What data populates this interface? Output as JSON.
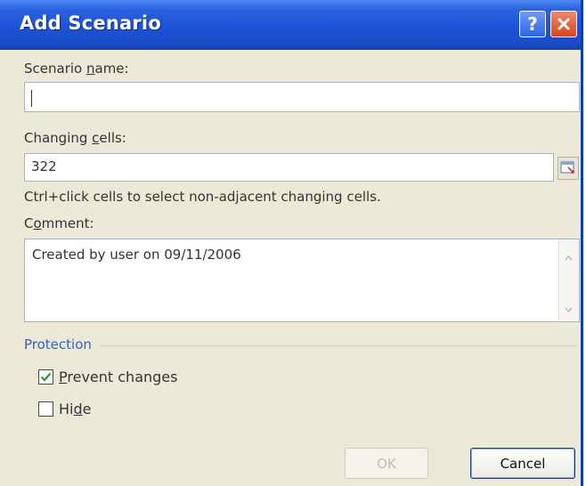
{
  "dialog": {
    "title": "Add Scenario",
    "help_symbol": "?",
    "scenario_name": {
      "label_prefix": "Scenario ",
      "label_access": "n",
      "label_suffix": "ame:",
      "value": ""
    },
    "changing_cells": {
      "label_prefix": "Changing ",
      "label_access": "c",
      "label_suffix": "ells:",
      "value": "322"
    },
    "hint": "Ctrl+click cells to select non-adjacent changing cells.",
    "comment": {
      "label_prefix": "C",
      "label_access": "o",
      "label_suffix": "mment:",
      "value": "Created by user on 09/11/2006"
    },
    "protection": {
      "title": "Protection",
      "prevent_changes": {
        "label_access": "P",
        "label_rest": "revent changes",
        "checked": true
      },
      "hide": {
        "label_prefix": "Hi",
        "label_access": "d",
        "label_suffix": "e",
        "checked": false
      }
    },
    "buttons": {
      "ok": "OK",
      "cancel": "Cancel"
    }
  }
}
